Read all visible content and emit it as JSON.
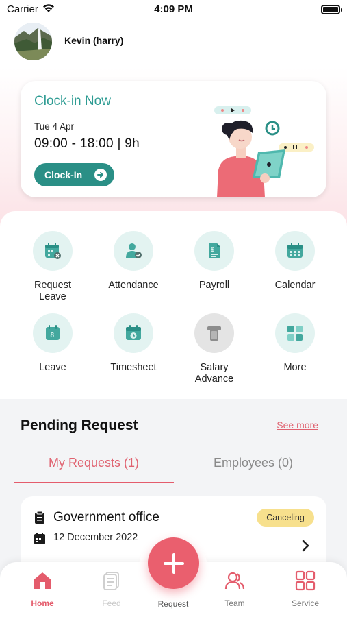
{
  "status_bar": {
    "carrier": "Carrier",
    "time": "4:09 PM"
  },
  "user": {
    "name": "Kevin (harry)"
  },
  "clock_card": {
    "title": "Clock-in Now",
    "date": "Tue 4 Apr",
    "hours": "09:00 - 18:00  | 9h",
    "button": "Clock-In"
  },
  "menu": {
    "items": [
      {
        "label": "Request Leave",
        "icon": "request-leave-icon"
      },
      {
        "label": "Attendance",
        "icon": "attendance-icon"
      },
      {
        "label": "Payroll",
        "icon": "payroll-icon"
      },
      {
        "label": "Calendar",
        "icon": "calendar-icon"
      },
      {
        "label": "Leave",
        "icon": "leave-icon"
      },
      {
        "label": "Timesheet",
        "icon": "timesheet-icon"
      },
      {
        "label": "Salary Advance",
        "icon": "salary-advance-icon"
      },
      {
        "label": "More",
        "icon": "more-icon"
      }
    ]
  },
  "pending": {
    "title": "Pending Request",
    "see_more": "See more",
    "tabs": [
      {
        "label": "My Requests (1)",
        "active": true
      },
      {
        "label": "Employees (0)",
        "active": false
      }
    ],
    "requests": [
      {
        "title": "Government office",
        "date": "12 December 2022",
        "status": "Canceling"
      }
    ]
  },
  "bottom_nav": {
    "home": "Home",
    "feed": "Feed",
    "request": "Request",
    "team": "Team",
    "service": "Service"
  },
  "colors": {
    "accent_teal": "#2a8f86",
    "accent_red": "#e45c6c",
    "badge_yellow": "#f7e08d"
  }
}
